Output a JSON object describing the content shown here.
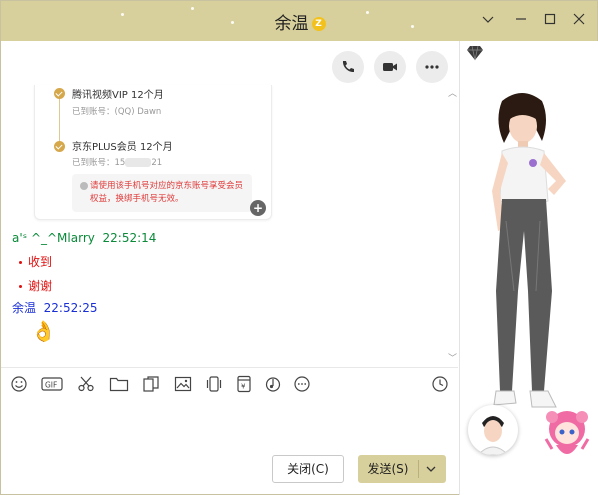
{
  "window": {
    "title": "余温",
    "badge": "Z",
    "accent_color": "#d8d09c",
    "controls": [
      "chevron-down-icon",
      "minimize-icon",
      "maximize-icon",
      "close-icon"
    ]
  },
  "actions": [
    "phone-icon",
    "video-icon",
    "more-icon"
  ],
  "card": {
    "items": [
      {
        "title": "腾讯视频VIP 12个月",
        "sub_prefix": "已到账号：",
        "sub_value": "(QQ) Dawn"
      },
      {
        "title": "京东PLUS会员 12个月",
        "sub_prefix": "已到账号：",
        "sub_value_start": "15",
        "sub_value_end": "21"
      }
    ],
    "notice": "请使用该手机号对应的京东账号享受会员权益，换绑手机号无效。"
  },
  "messages": [
    {
      "sender": "a'ˢ   ^_^Mlarry",
      "time": "22:52:14",
      "lines": [
        "收到",
        "谢谢"
      ]
    },
    {
      "sender": "余温",
      "time": "22:52:25",
      "emoji": "👌"
    }
  ],
  "toolbar": [
    "emoji-icon",
    "gif-icon",
    "scissors-icon",
    "folder-icon",
    "sticker-icon",
    "image-icon",
    "shake-icon",
    "red-packet-icon",
    "music-icon",
    "more-icon",
    "history-clock-icon"
  ],
  "buttons": {
    "close": "关闭(C)",
    "send": "发送(S)"
  }
}
